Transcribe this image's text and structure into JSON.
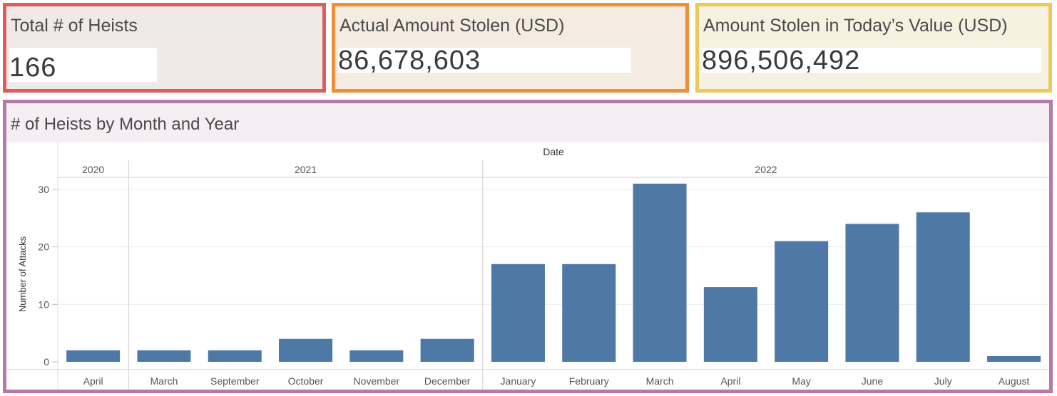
{
  "kpis": [
    {
      "title": "Total # of Heists",
      "value": "166",
      "color": "#df5c5c"
    },
    {
      "title": "Actual Amount Stolen (USD)",
      "value": "86,678,603",
      "color": "#f08f35"
    },
    {
      "title": "Amount Stolen in Today’s Value (USD)",
      "value": "896,506,492",
      "color": "#ecc95a"
    }
  ],
  "chart_panel": {
    "title": "# of Heists by Month and Year",
    "border_color": "#b57aa8"
  },
  "chart_data": {
    "type": "bar",
    "xlabel": "Date",
    "ylabel": "Number of Attacks",
    "ylim": [
      0,
      32
    ],
    "yticks": [
      0,
      10,
      20,
      30
    ],
    "bar_color": "#4e79a7",
    "years": [
      {
        "label": "2020",
        "months": 1
      },
      {
        "label": "2021",
        "months": 5
      },
      {
        "label": "2022",
        "months": 8
      }
    ],
    "categories": [
      "April",
      "March",
      "September",
      "October",
      "November",
      "December",
      "January",
      "February",
      "March",
      "April",
      "May",
      "June",
      "July",
      "August"
    ],
    "values": [
      2,
      2,
      2,
      4,
      2,
      4,
      17,
      17,
      31,
      13,
      21,
      24,
      26,
      1
    ]
  }
}
